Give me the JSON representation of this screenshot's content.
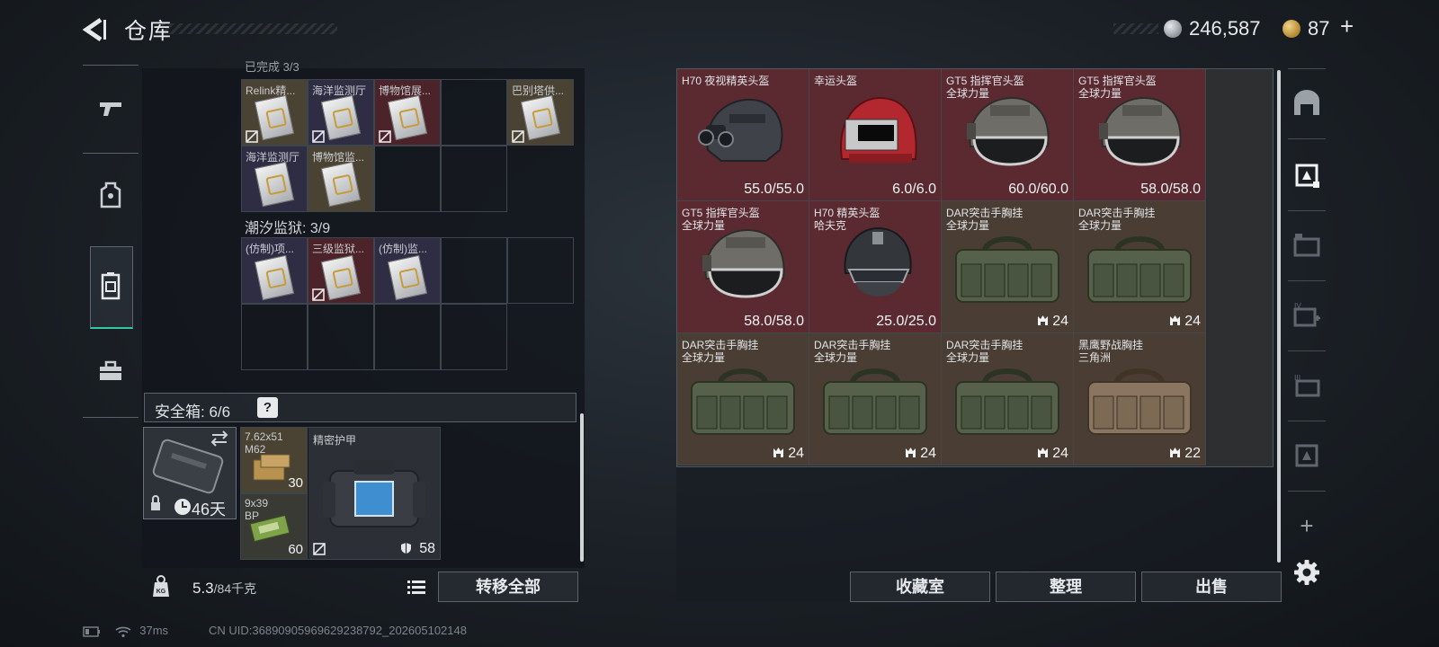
{
  "header": {
    "title": "仓库",
    "silver_amount": "246,587",
    "gold_amount": "87",
    "gold_plus": "+"
  },
  "left": {
    "section_top_label": "已完成 3/3",
    "tide_label": "潮汐监狱: 3/9",
    "top_items": [
      {
        "label": "Relink精..."
      },
      {
        "label": "海洋监测厅"
      },
      {
        "label": "博物馆展..."
      },
      {
        "label": "巴别塔供..."
      },
      {
        "label": "海洋监测厅"
      },
      {
        "label": "博物馆监..."
      }
    ],
    "tide_items": [
      {
        "label": "(仿制)项..."
      },
      {
        "label": "三级监狱..."
      },
      {
        "label": "(仿制)监..."
      }
    ],
    "safebox": {
      "label": "安全箱: 6/6",
      "help": "?",
      "days": "46天"
    },
    "safe_items": {
      "ammo1_line1": "7.62x51",
      "ammo1_line2": "M62",
      "ammo1_count": "30",
      "ammo2_line1": "9x39",
      "ammo2_line2": "BP",
      "ammo2_count": "60",
      "armor_name": "精密护甲",
      "armor_durability": "58"
    },
    "weight": {
      "current": "5.3",
      "max": "/84千克"
    },
    "transfer_all": "转移全部"
  },
  "right": {
    "items": [
      {
        "name": "H70 夜视精英头盔",
        "sub": "",
        "value": "55.0/55.0",
        "kind": "helmet-nv",
        "bg": "red"
      },
      {
        "name": "幸运头盔",
        "sub": "",
        "value": "6.0/6.0",
        "kind": "helmet-lucky",
        "bg": "red"
      },
      {
        "name": "GT5 指挥官头盔",
        "sub": "全球力量",
        "value": "60.0/60.0",
        "kind": "helmet-gt5",
        "bg": "red"
      },
      {
        "name": "GT5 指挥官头盔",
        "sub": "全球力量",
        "value": "58.0/58.0",
        "kind": "helmet-gt5",
        "bg": "red"
      },
      {
        "name": "GT5 指挥官头盔",
        "sub": "全球力量",
        "value": "58.0/58.0",
        "kind": "helmet-gt5",
        "bg": "red"
      },
      {
        "name": "H70 精英头盔",
        "sub": "哈夫克",
        "value": "25.0/25.0",
        "kind": "helmet-h70",
        "bg": "red"
      },
      {
        "name": "DAR突击手胸挂",
        "sub": "全球力量",
        "value": "24",
        "kind": "rig-green",
        "bg": "brown"
      },
      {
        "name": "DAR突击手胸挂",
        "sub": "全球力量",
        "value": "24",
        "kind": "rig-green",
        "bg": "brown"
      },
      {
        "name": "DAR突击手胸挂",
        "sub": "全球力量",
        "value": "24",
        "kind": "rig-green",
        "bg": "brown"
      },
      {
        "name": "DAR突击手胸挂",
        "sub": "全球力量",
        "value": "24",
        "kind": "rig-green",
        "bg": "brown"
      },
      {
        "name": "DAR突击手胸挂",
        "sub": "全球力量",
        "value": "24",
        "kind": "rig-green",
        "bg": "brown"
      },
      {
        "name": "黑鹰野战胸挂",
        "sub": "三角洲",
        "value": "22",
        "kind": "rig-tan",
        "bg": "brown"
      }
    ],
    "btn_collection": "收藏室",
    "btn_sort": "整理",
    "btn_sell": "出售"
  },
  "rail": {
    "plus": "+"
  },
  "status": {
    "ping": "37ms",
    "uid": "CN UID:3689090596962923879​2_202605102148"
  },
  "colors": {
    "accent_teal": "#37c5a4",
    "item_red": "#5a2a30",
    "item_brown": "#4a3e34",
    "item_purple": "#2e2d44",
    "item_tan": "#4a4334"
  }
}
